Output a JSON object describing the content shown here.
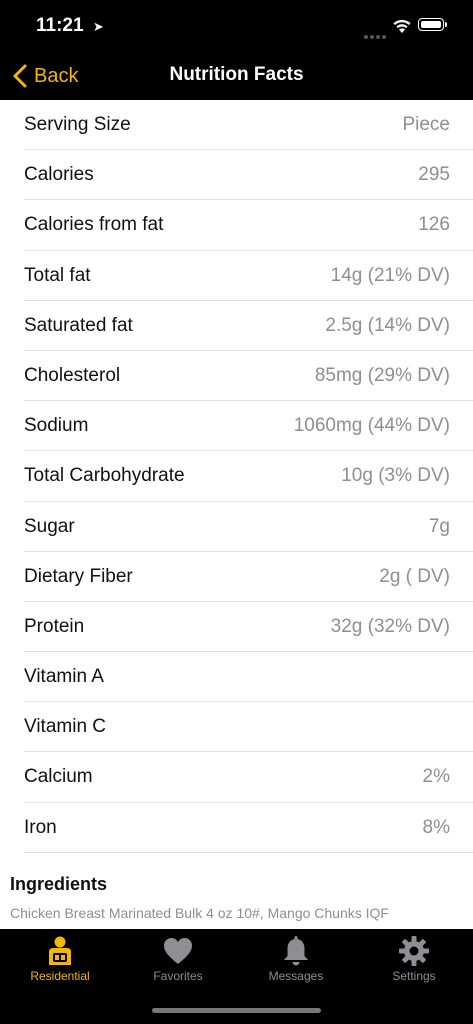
{
  "status": {
    "time": "11:21",
    "location_icon": "location-arrow-icon"
  },
  "nav": {
    "back_label": "Back",
    "title": "Nutrition Facts"
  },
  "rows": [
    {
      "label": "Serving Size",
      "value": "Piece"
    },
    {
      "label": "Calories",
      "value": "295"
    },
    {
      "label": "Calories from fat",
      "value": "126"
    },
    {
      "label": "Total fat",
      "value": "14g (21% DV)"
    },
    {
      "label": "Saturated fat",
      "value": "2.5g (14% DV)"
    },
    {
      "label": "Cholesterol",
      "value": "85mg (29% DV)"
    },
    {
      "label": "Sodium",
      "value": "1060mg (44% DV)"
    },
    {
      "label": "Total Carbohydrate",
      "value": "10g (3% DV)"
    },
    {
      "label": "Sugar",
      "value": "7g"
    },
    {
      "label": "Dietary Fiber",
      "value": "2g ( DV)"
    },
    {
      "label": "Protein",
      "value": "32g (32% DV)"
    },
    {
      "label": "Vitamin A",
      "value": ""
    },
    {
      "label": "Vitamin C",
      "value": ""
    },
    {
      "label": "Calcium",
      "value": "2%"
    },
    {
      "label": "Iron",
      "value": "8%"
    }
  ],
  "ingredients": {
    "title": "Ingredients",
    "text": "Chicken Breast Marinated Bulk 4 oz 10#, Mango Chunks IQF"
  },
  "tabs": [
    {
      "label": "Residential",
      "icon": "residential-icon",
      "active": true
    },
    {
      "label": "Favorites",
      "icon": "heart-icon",
      "active": false
    },
    {
      "label": "Messages",
      "icon": "bell-icon",
      "active": false
    },
    {
      "label": "Settings",
      "icon": "gear-icon",
      "active": false
    }
  ],
  "colors": {
    "accent": "#f2b705",
    "bar": "#000000",
    "muted": "#8e8e93"
  }
}
